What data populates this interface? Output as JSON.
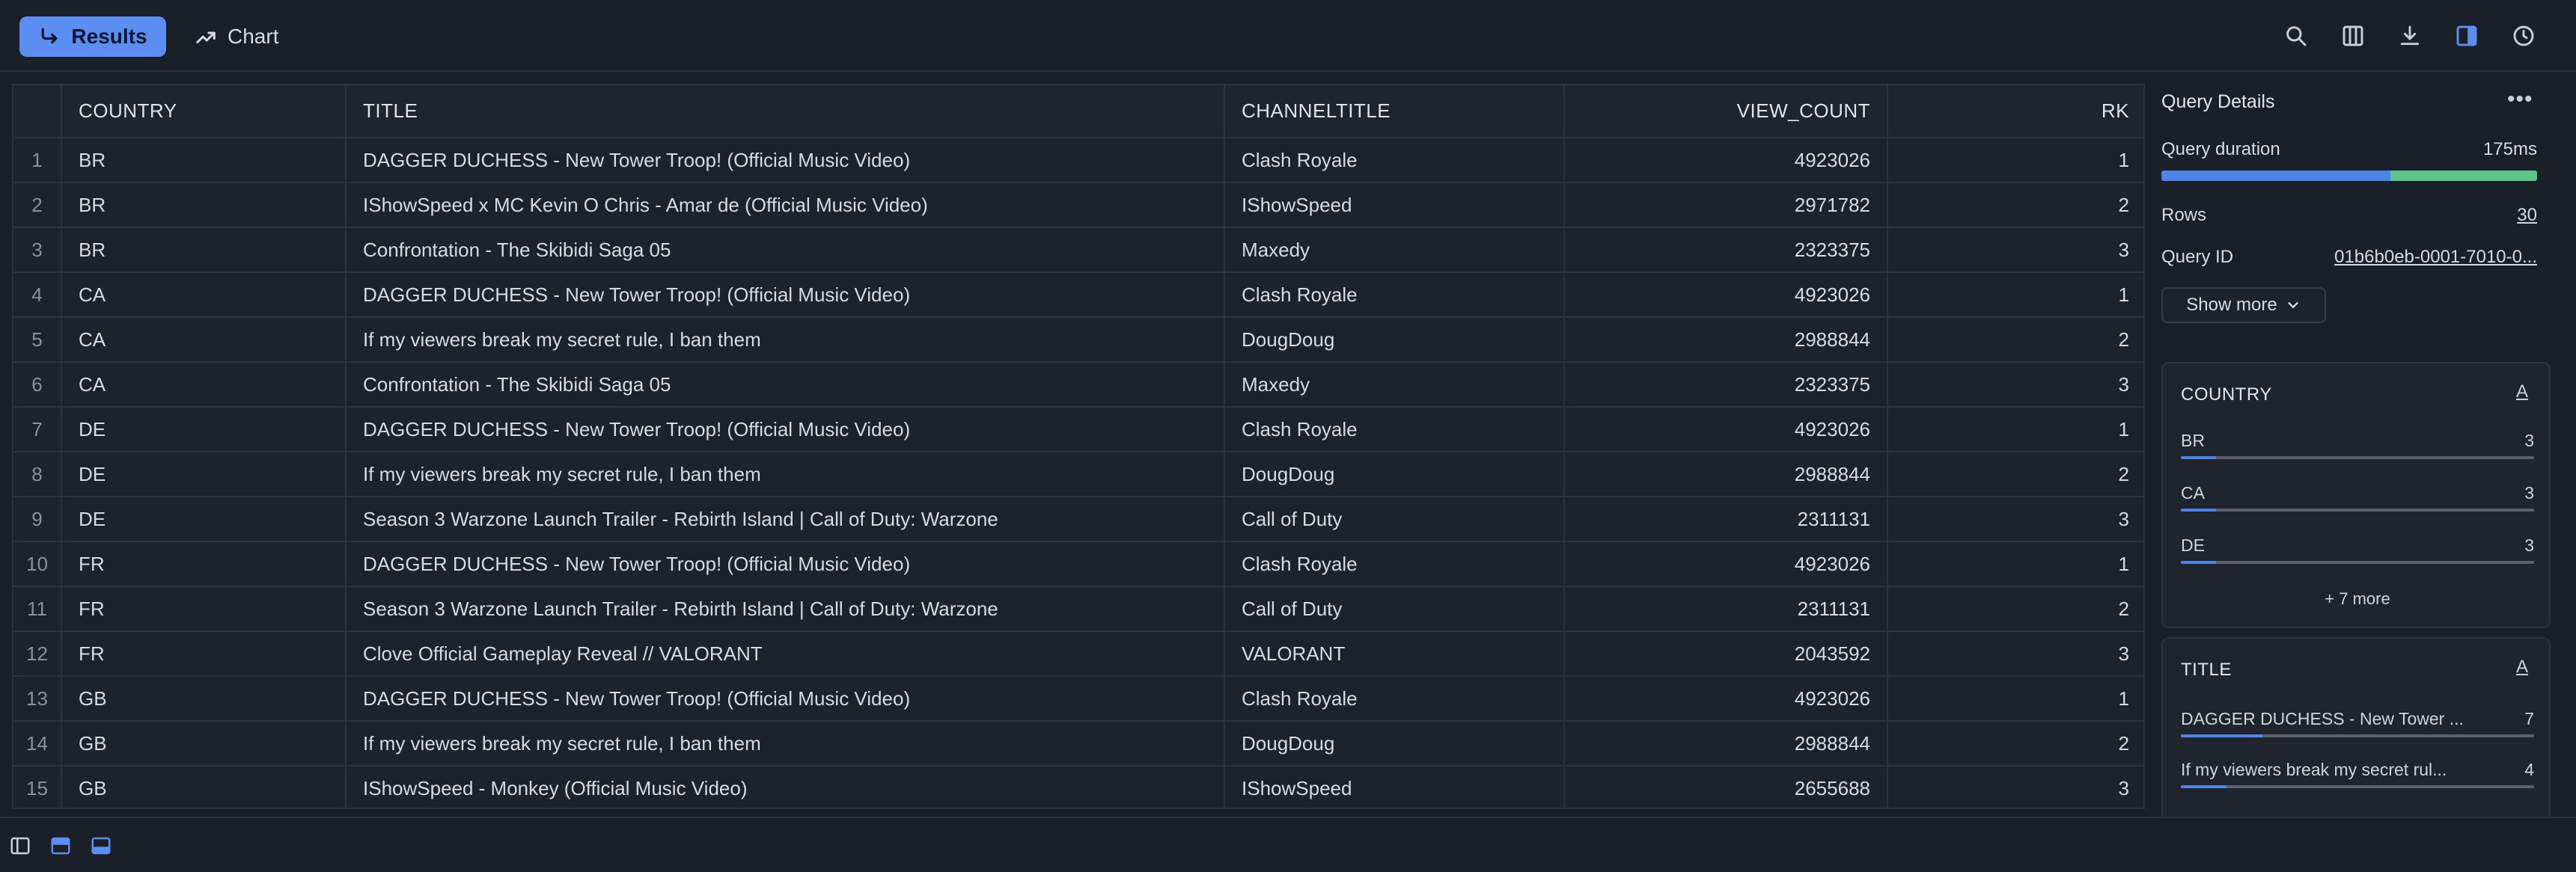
{
  "toolbar": {
    "tabs": [
      {
        "label": "Results",
        "icon": "return-arrow-icon"
      },
      {
        "label": "Chart",
        "icon": "trend-line-icon"
      }
    ],
    "icons": [
      "search-icon",
      "columns-icon",
      "download-icon",
      "panel-toggle-icon",
      "history-clock-icon"
    ],
    "accent": "#5b8ef0"
  },
  "table": {
    "columns": [
      "COUNTRY",
      "TITLE",
      "CHANNELTITLE",
      "VIEW_COUNT",
      "RK"
    ],
    "rows": [
      [
        "1",
        "BR",
        "DAGGER DUCHESS - New Tower Troop! (Official Music Video)",
        "Clash Royale",
        "4923026",
        "1"
      ],
      [
        "2",
        "BR",
        "IShowSpeed x MC Kevin O Chris - Amar de (Official Music Video)",
        "IShowSpeed",
        "2971782",
        "2"
      ],
      [
        "3",
        "BR",
        "Confrontation - The Skibidi Saga 05",
        "Maxedy",
        "2323375",
        "3"
      ],
      [
        "4",
        "CA",
        "DAGGER DUCHESS - New Tower Troop! (Official Music Video)",
        "Clash Royale",
        "4923026",
        "1"
      ],
      [
        "5",
        "CA",
        "If my viewers break my secret rule, I ban them",
        "DougDoug",
        "2988844",
        "2"
      ],
      [
        "6",
        "CA",
        "Confrontation - The Skibidi Saga 05",
        "Maxedy",
        "2323375",
        "3"
      ],
      [
        "7",
        "DE",
        "DAGGER DUCHESS - New Tower Troop! (Official Music Video)",
        "Clash Royale",
        "4923026",
        "1"
      ],
      [
        "8",
        "DE",
        "If my viewers break my secret rule, I ban them",
        "DougDoug",
        "2988844",
        "2"
      ],
      [
        "9",
        "DE",
        "Season 3 Warzone Launch Trailer - Rebirth Island | Call of Duty: Warzone",
        "Call of Duty",
        "2311131",
        "3"
      ],
      [
        "10",
        "FR",
        "DAGGER DUCHESS - New Tower Troop! (Official Music Video)",
        "Clash Royale",
        "4923026",
        "1"
      ],
      [
        "11",
        "FR",
        "Season 3 Warzone Launch Trailer - Rebirth Island | Call of Duty: Warzone",
        "Call of Duty",
        "2311131",
        "2"
      ],
      [
        "12",
        "FR",
        "Clove Official Gameplay Reveal // VALORANT",
        "VALORANT",
        "2043592",
        "3"
      ],
      [
        "13",
        "GB",
        "DAGGER DUCHESS - New Tower Troop! (Official Music Video)",
        "Clash Royale",
        "4923026",
        "1"
      ],
      [
        "14",
        "GB",
        "If my viewers break my secret rule, I ban them",
        "DougDoug",
        "2988844",
        "2"
      ],
      [
        "15",
        "GB",
        "IShowSpeed - Monkey  (Official Music Video)",
        "IShowSpeed",
        "2655688",
        "3"
      ]
    ]
  },
  "details": {
    "title": "Query Details",
    "duration_label": "Query duration",
    "duration_value": "175ms",
    "duration_split": [
      0.61,
      0.39
    ],
    "rows_label": "Rows",
    "rows_value": "30",
    "query_id_label": "Query ID",
    "query_id_value": "01b6b0eb-0001-7010-0...",
    "show_more": "Show more"
  },
  "column_stats": [
    {
      "title": "COUNTRY",
      "sort": "A",
      "items": [
        {
          "label": "BR",
          "count": "3",
          "fraction": 0.1
        },
        {
          "label": "CA",
          "count": "3",
          "fraction": 0.1
        },
        {
          "label": "DE",
          "count": "3",
          "fraction": 0.1
        }
      ],
      "more": "+ 7 more"
    },
    {
      "title": "TITLE",
      "sort": "A",
      "items": [
        {
          "label": "DAGGER DUCHESS - New Tower ...",
          "count": "7",
          "fraction": 0.23
        },
        {
          "label": "If my viewers break my secret rul...",
          "count": "4",
          "fraction": 0.13
        }
      ]
    }
  ],
  "bottombar": {
    "icons": [
      "sidebar-left-icon",
      "panel-top-icon",
      "panel-bottom-icon"
    ]
  }
}
